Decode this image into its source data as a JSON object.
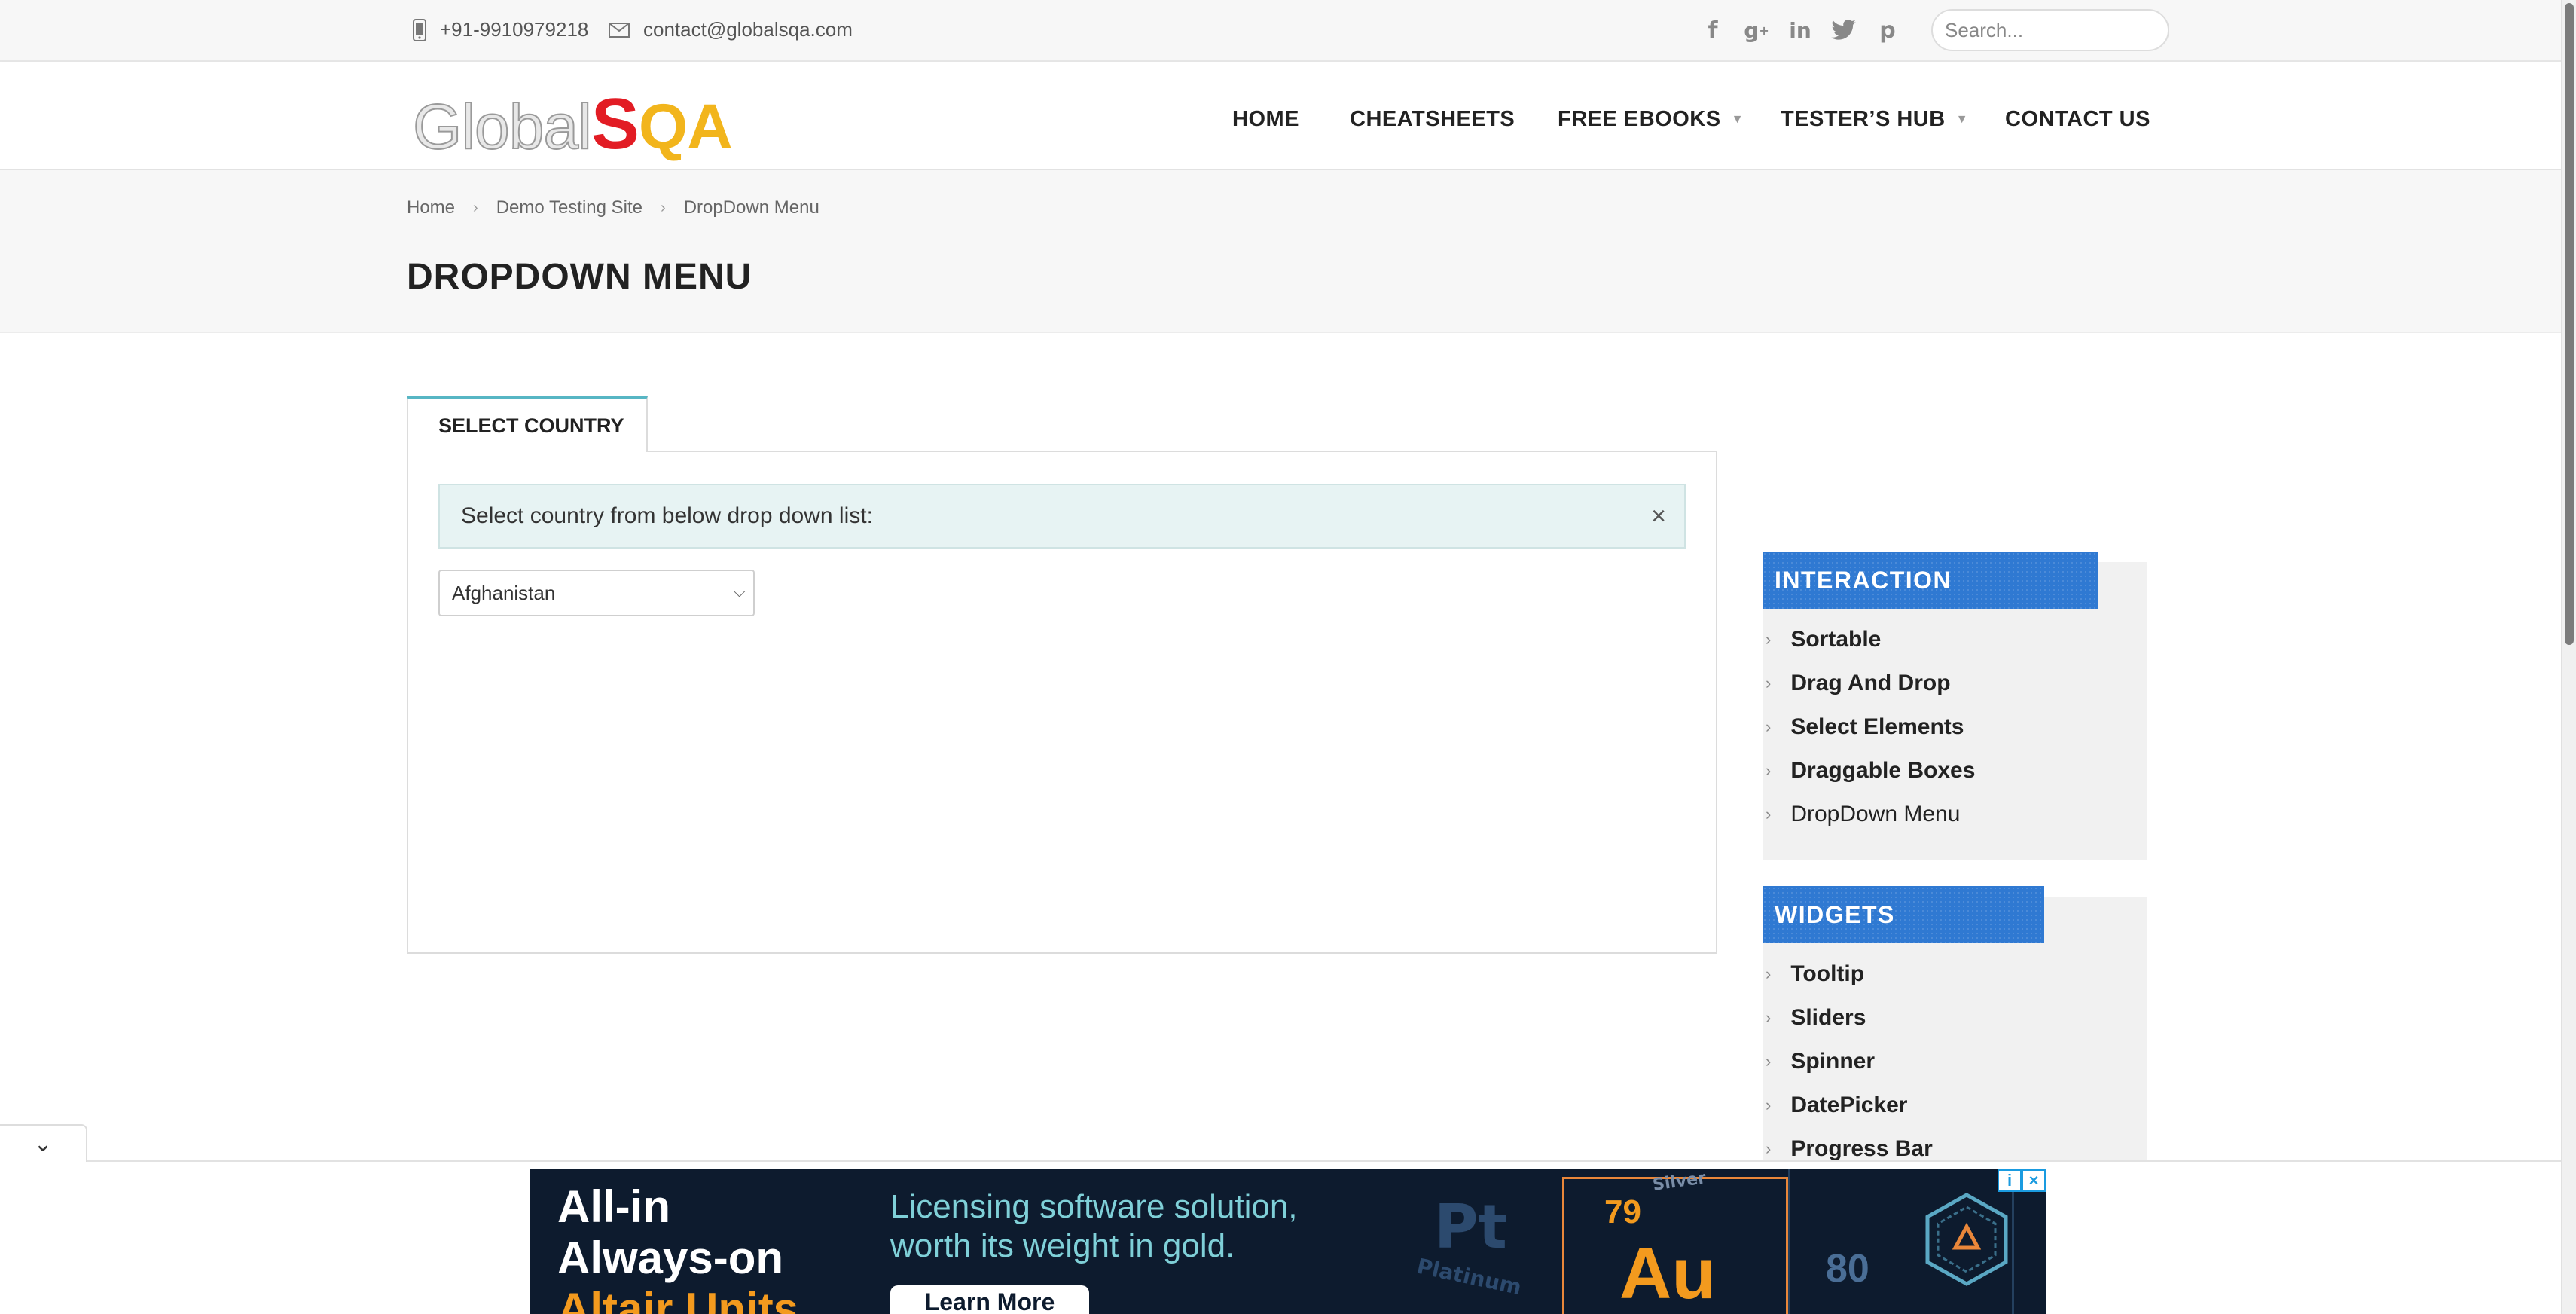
{
  "topbar": {
    "phone": "+91-9910979218",
    "email": "contact@globalsqa.com",
    "social_icons": [
      "facebook-icon",
      "google-plus-icon",
      "linkedin-icon",
      "twitter-icon",
      "pinterest-icon"
    ],
    "search_placeholder": "Search..."
  },
  "logo": {
    "part1": "Global",
    "part2": "S",
    "part3": "QA"
  },
  "nav": {
    "home": "HOME",
    "cheatsheets": "CHEATSHEETS",
    "free_ebooks": "FREE EBOOKS",
    "testers_hub": "TESTER’S HUB",
    "contact_us": "CONTACT US"
  },
  "breadcrumb": {
    "home": "Home",
    "demo": "Demo Testing Site",
    "current": "DropDown Menu"
  },
  "page_title": "DROPDOWN MENU",
  "tab_label": "SELECT COUNTRY",
  "alert": {
    "text": "Select country from below drop down list:",
    "close": "×"
  },
  "country_select": {
    "selected": "Afghanistan"
  },
  "sidebar": {
    "interaction": {
      "title": "INTERACTION",
      "items": [
        "Sortable",
        "Drag And Drop",
        "Select Elements",
        "Draggable Boxes",
        "DropDown Menu"
      ]
    },
    "widgets": {
      "title": "WIDGETS",
      "items": [
        "Tooltip",
        "Sliders",
        "Spinner",
        "DatePicker",
        "Progress Bar"
      ]
    }
  },
  "ad": {
    "line1": "All-in",
    "line2": "Always-on",
    "line3": "Altair Units",
    "sub1": "Licensing software solution,",
    "sub2": "worth its weight in gold.",
    "button": "Learn More",
    "element_number": "79",
    "element_symbol": "Au",
    "next_number": "80",
    "pt_symbol": "Pt",
    "pt_name": "Platinum",
    "silver_label": "Silver"
  },
  "colors": {
    "accent_teal": "#57b6c4",
    "sidebar_header_blue": "#2f79d2",
    "logo_red": "#e21c24",
    "logo_gold": "#f2b51c"
  }
}
